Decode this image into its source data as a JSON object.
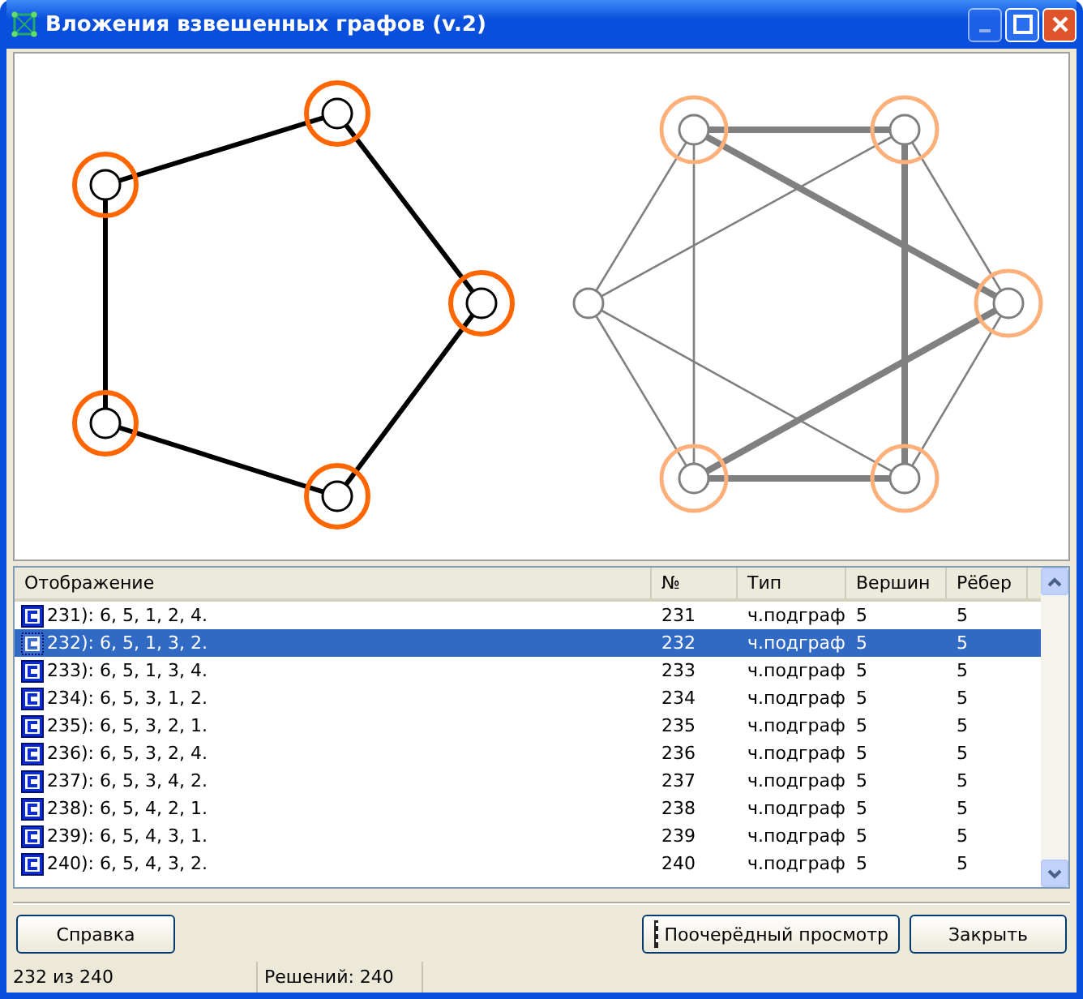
{
  "window": {
    "title": "Вложения взвешенных графов (v.2)"
  },
  "table": {
    "columns": [
      "Отображение",
      "№",
      "Тип",
      "Вершин",
      "Рёбер"
    ],
    "rows": [
      {
        "cells": [
          "231): 6, 5, 1, 2, 4.",
          "231",
          "ч.подграф",
          "5",
          "5"
        ],
        "selected": false
      },
      {
        "cells": [
          "232): 6, 5, 1, 3, 2.",
          "232",
          "ч.подграф",
          "5",
          "5"
        ],
        "selected": true
      },
      {
        "cells": [
          "233): 6, 5, 1, 3, 4.",
          "233",
          "ч.подграф",
          "5",
          "5"
        ],
        "selected": false
      },
      {
        "cells": [
          "234): 6, 5, 3, 1, 2.",
          "234",
          "ч.подграф",
          "5",
          "5"
        ],
        "selected": false
      },
      {
        "cells": [
          "235): 6, 5, 3, 2, 1.",
          "235",
          "ч.подграф",
          "5",
          "5"
        ],
        "selected": false
      },
      {
        "cells": [
          "236): 6, 5, 3, 2, 4.",
          "236",
          "ч.подграф",
          "5",
          "5"
        ],
        "selected": false
      },
      {
        "cells": [
          "237): 6, 5, 3, 4, 2.",
          "237",
          "ч.подграф",
          "5",
          "5"
        ],
        "selected": false
      },
      {
        "cells": [
          "238): 6, 5, 4, 2, 1.",
          "238",
          "ч.подграф",
          "5",
          "5"
        ],
        "selected": false
      },
      {
        "cells": [
          "239): 6, 5, 4, 3, 1.",
          "239",
          "ч.подграф",
          "5",
          "5"
        ],
        "selected": false
      },
      {
        "cells": [
          "240): 6, 5, 4, 3, 2.",
          "240",
          "ч.подграф",
          "5",
          "5"
        ],
        "selected": false
      }
    ]
  },
  "buttons": {
    "help": "Справка",
    "slideshow": "Поочерёдный просмотр",
    "close": "Закрыть"
  },
  "status_bar": [
    "232 из 240",
    "Решений: 240"
  ]
}
